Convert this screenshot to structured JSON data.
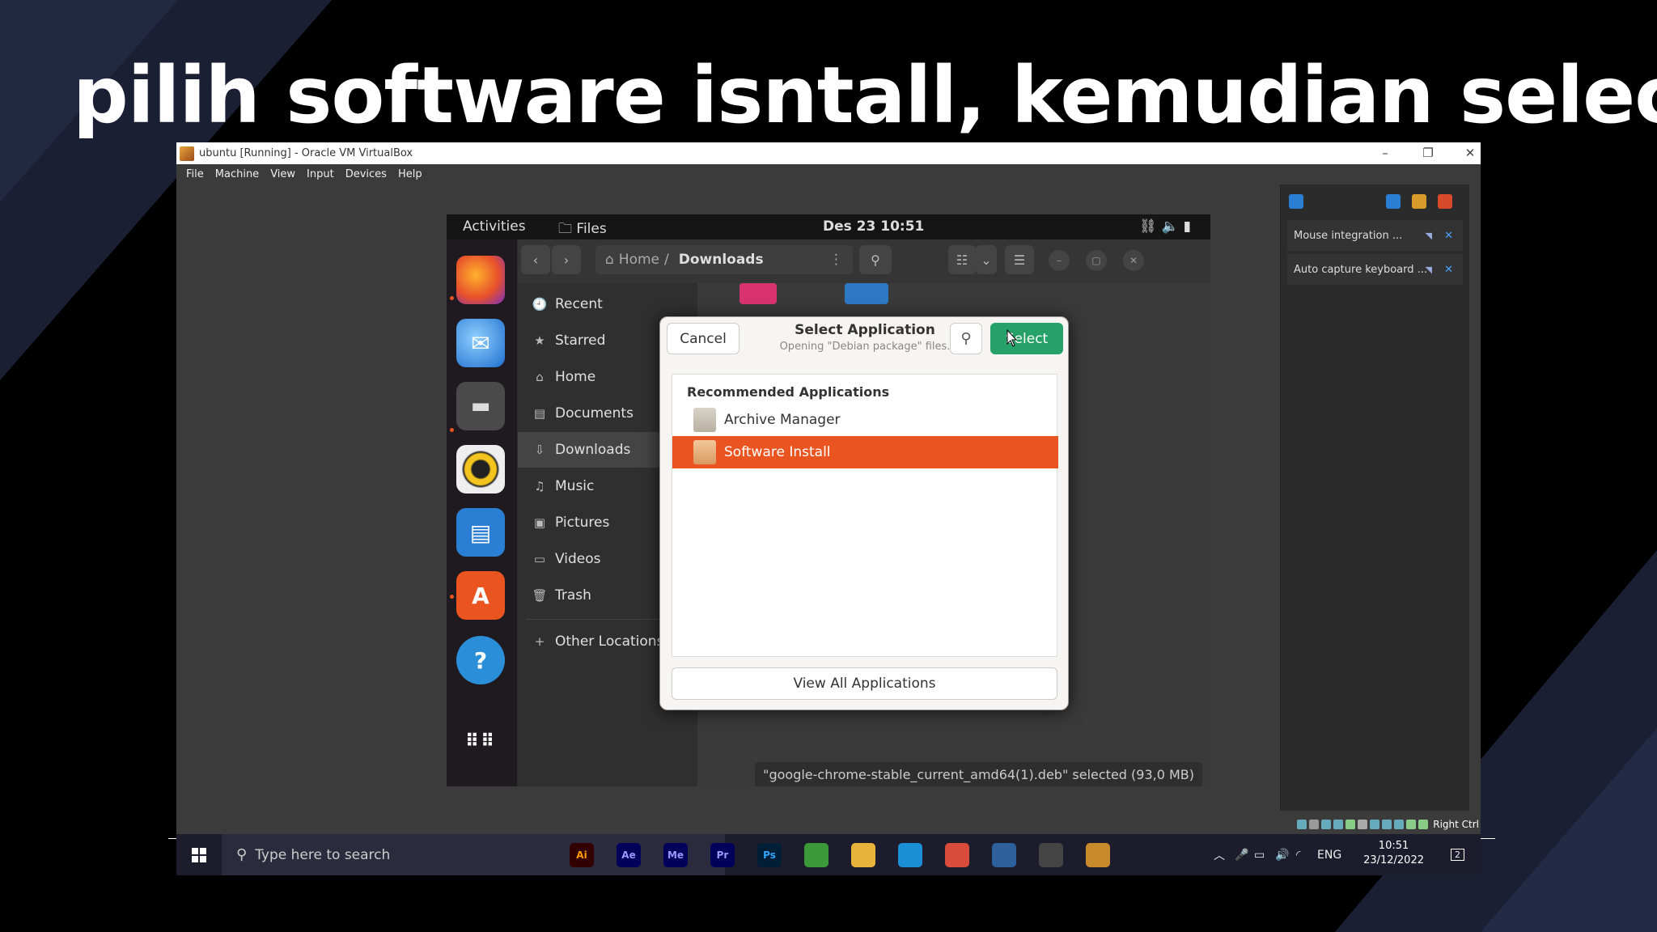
{
  "slide": {
    "title": "pilih software isntall, kemudian select"
  },
  "virtualbox": {
    "window_title": "ubuntu [Running] - Oracle VM VirtualBox",
    "menu": [
      "File",
      "Machine",
      "View",
      "Input",
      "Devices",
      "Help"
    ],
    "notifications": [
      {
        "label": "Mouse integration ..."
      },
      {
        "label": "Auto capture keyboard ..."
      }
    ],
    "host_key": "Right Ctrl"
  },
  "ubuntu": {
    "topbar": {
      "activities": "Activities",
      "app": "Files",
      "clock": "Des 23  10:51"
    },
    "dock": [
      {
        "name": "firefox-icon"
      },
      {
        "name": "thunderbird-icon"
      },
      {
        "name": "files-icon"
      },
      {
        "name": "rhythmbox-icon"
      },
      {
        "name": "writer-icon"
      },
      {
        "name": "software-center-icon"
      },
      {
        "name": "help-icon"
      },
      {
        "name": "app-grid-icon"
      }
    ],
    "files": {
      "path": {
        "home": "Home",
        "current": "Downloads"
      },
      "sidebar": [
        {
          "label": "Recent",
          "icon": "🕘"
        },
        {
          "label": "Starred",
          "icon": "★"
        },
        {
          "label": "Home",
          "icon": "⌂"
        },
        {
          "label": "Documents",
          "icon": "▤"
        },
        {
          "label": "Downloads",
          "icon": "⇩"
        },
        {
          "label": "Music",
          "icon": "♫"
        },
        {
          "label": "Pictures",
          "icon": "▣"
        },
        {
          "label": "Videos",
          "icon": "▭"
        },
        {
          "label": "Trash",
          "icon": "🗑"
        },
        {
          "label": "Other Locations",
          "icon": "+"
        }
      ],
      "status": "\"google-chrome-stable_current_amd64(1).deb\" selected  (93,0 MB)"
    },
    "dialog": {
      "cancel": "Cancel",
      "title": "Select Application",
      "subtitle": "Opening \"Debian package\" files.",
      "select": "Select",
      "section": "Recommended Applications",
      "apps": [
        {
          "label": "Archive Manager",
          "selected": false
        },
        {
          "label": "Software Install",
          "selected": true
        }
      ],
      "view_all": "View All Applications"
    }
  },
  "windows": {
    "search_placeholder": "Type here to search",
    "taskbar_apps": [
      {
        "name": "illustrator-icon",
        "label": "Ai",
        "color": "#ff9a00",
        "bg": "#330000"
      },
      {
        "name": "after-effects-icon",
        "label": "Ae",
        "color": "#9999ff",
        "bg": "#00005b"
      },
      {
        "name": "media-encoder-icon",
        "label": "Me",
        "color": "#9999ff",
        "bg": "#00005b"
      },
      {
        "name": "premiere-icon",
        "label": "Pr",
        "color": "#9999ff",
        "bg": "#00005b"
      },
      {
        "name": "photoshop-icon",
        "label": "Ps",
        "color": "#31a8ff",
        "bg": "#001e36"
      },
      {
        "name": "maps-icon",
        "label": "",
        "color": "#fff",
        "bg": "#3a9a3a"
      },
      {
        "name": "file-explorer-icon",
        "label": "",
        "color": "#fff",
        "bg": "#e8b33a"
      },
      {
        "name": "edge-icon",
        "label": "",
        "color": "#fff",
        "bg": "#1b8fd6"
      },
      {
        "name": "chrome-icon",
        "label": "",
        "color": "#fff",
        "bg": "#d94b3a"
      },
      {
        "name": "virtualbox-manager-icon",
        "label": "",
        "color": "#fff",
        "bg": "#2d5f9a"
      },
      {
        "name": "recorder-icon",
        "label": "",
        "color": "#fff",
        "bg": "#444"
      },
      {
        "name": "virtualbox-vm-icon",
        "label": "",
        "color": "#fff",
        "bg": "#c88a2a"
      }
    ],
    "lang": "ENG",
    "time": "10:51",
    "date": "23/12/2022",
    "notif_count": "2"
  }
}
